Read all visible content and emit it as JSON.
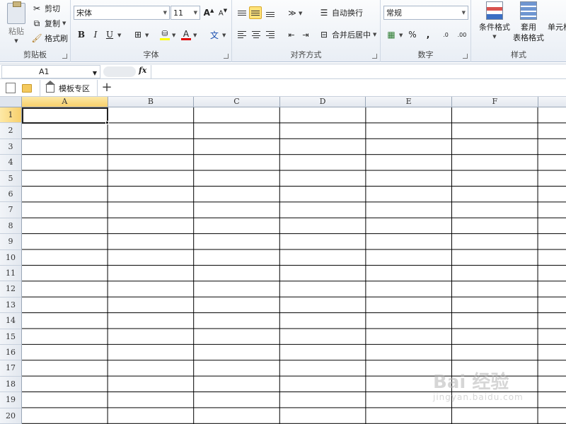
{
  "ribbon": {
    "clipboard": {
      "paste": "粘贴",
      "cut": "剪切",
      "copy": "复制",
      "format_painter": "格式刷",
      "group_label": "剪贴板"
    },
    "font": {
      "font_name": "宋体",
      "font_size": "11",
      "bold": "B",
      "italic": "I",
      "underline": "U",
      "font_color_glyph": "A",
      "phonetic_glyph": "文",
      "group_label": "字体"
    },
    "alignment": {
      "wrap_text": "自动换行",
      "merge_center": "合并后居中",
      "group_label": "对齐方式"
    },
    "number": {
      "format": "常规",
      "percent": "%",
      "comma": ",",
      "inc_decimal": ".0",
      "dec_decimal": ".00",
      "group_label": "数字"
    },
    "styles": {
      "conditional_format": "条件格式",
      "table_format_line1": "套用",
      "table_format_line2": "表格格式",
      "cell_styles": "单元格",
      "group_label": "样式"
    }
  },
  "formula_bar": {
    "name_box": "A1",
    "fx": "fx",
    "formula": ""
  },
  "tabs": {
    "template_area": "模板专区",
    "add": "+"
  },
  "sheet": {
    "columns": [
      "A",
      "B",
      "C",
      "D",
      "E",
      "F"
    ],
    "rows": [
      "1",
      "2",
      "3",
      "4",
      "5",
      "6",
      "7",
      "8",
      "9",
      "10",
      "11",
      "12",
      "13",
      "14",
      "15",
      "16",
      "17",
      "18",
      "19",
      "20"
    ],
    "active_cell": "A1"
  },
  "watermark": {
    "brand": "Bai  经验",
    "url": "jingyan.baidu.com"
  }
}
